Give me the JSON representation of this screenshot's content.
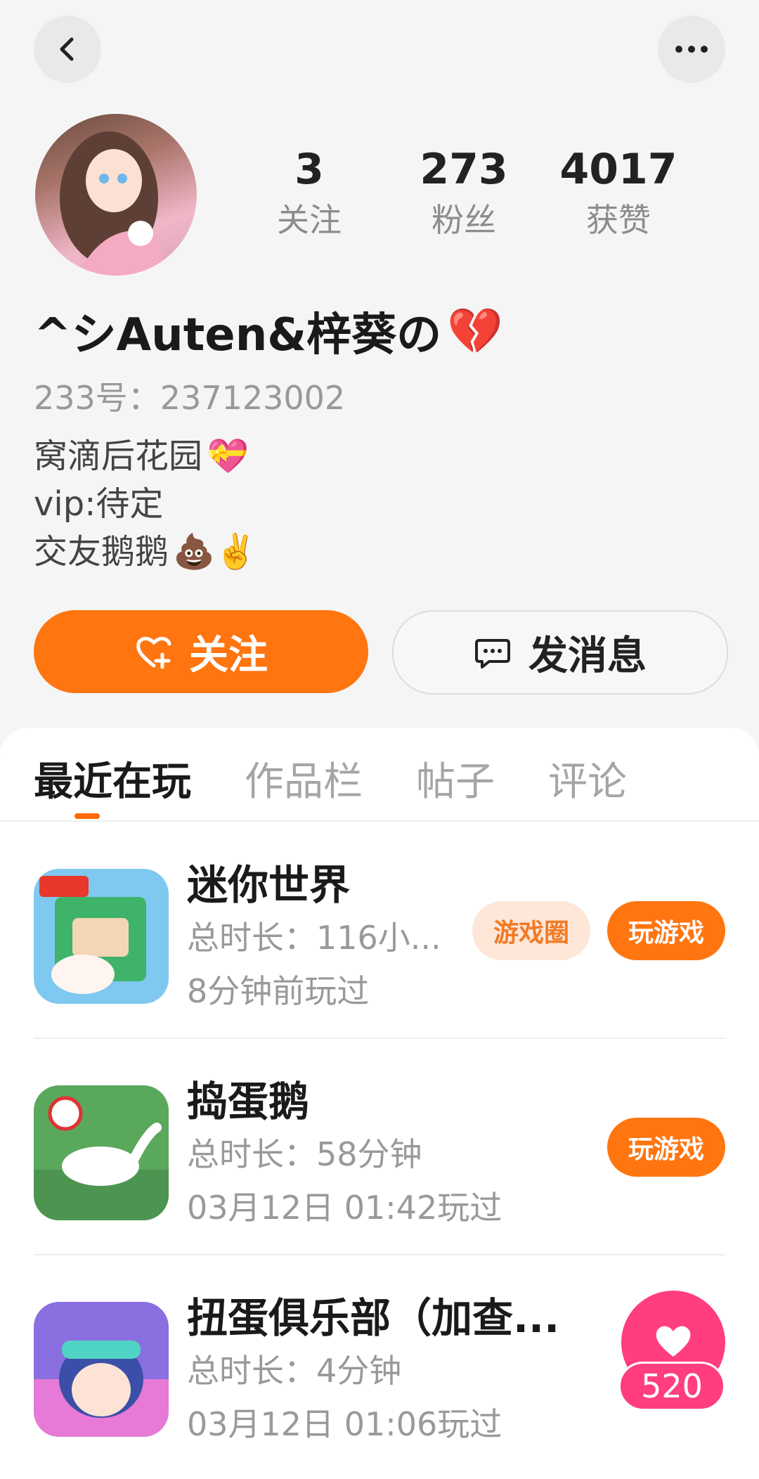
{
  "header": {
    "back_icon": "chevron-left-icon",
    "more_icon": "more-horizontal-icon"
  },
  "profile": {
    "stats": [
      {
        "value": "3",
        "label": "关注"
      },
      {
        "value": "273",
        "label": "粉丝"
      },
      {
        "value": "4017",
        "label": "获赞"
      }
    ],
    "username": "^シAuten&梓葵の",
    "username_emoji": "💔",
    "uid": "233号：237123002",
    "bio": [
      {
        "text": "窝滴后花园",
        "emoji": "💝"
      },
      {
        "text": "vip:待定",
        "emoji": ""
      },
      {
        "text": "交友鹅鹅",
        "emoji": "💩✌️"
      }
    ]
  },
  "actions": {
    "follow_label": "关注",
    "message_label": "发消息",
    "accent_color": "#ff7510"
  },
  "tabs": [
    {
      "label": "最近在玩",
      "active": true
    },
    {
      "label": "作品栏",
      "active": false
    },
    {
      "label": "帖子",
      "active": false
    },
    {
      "label": "评论",
      "active": false
    }
  ],
  "games": [
    {
      "title": "迷你世界",
      "duration": "总时长：116小...",
      "last_played": "8分钟前玩过",
      "circle_label": "游戏圈",
      "play_label": "玩游戏"
    },
    {
      "title": "捣蛋鹅",
      "duration": "总时长：58分钟",
      "last_played": "03月12日 01:42玩过",
      "play_label": "玩游戏"
    },
    {
      "title": "扭蛋俱乐部（加查...",
      "duration": "总时长：4分钟",
      "last_played": "03月12日 01:06玩过"
    }
  ],
  "floating": {
    "icon": "heart-icon",
    "count": "520",
    "color": "#ff3d7f"
  }
}
